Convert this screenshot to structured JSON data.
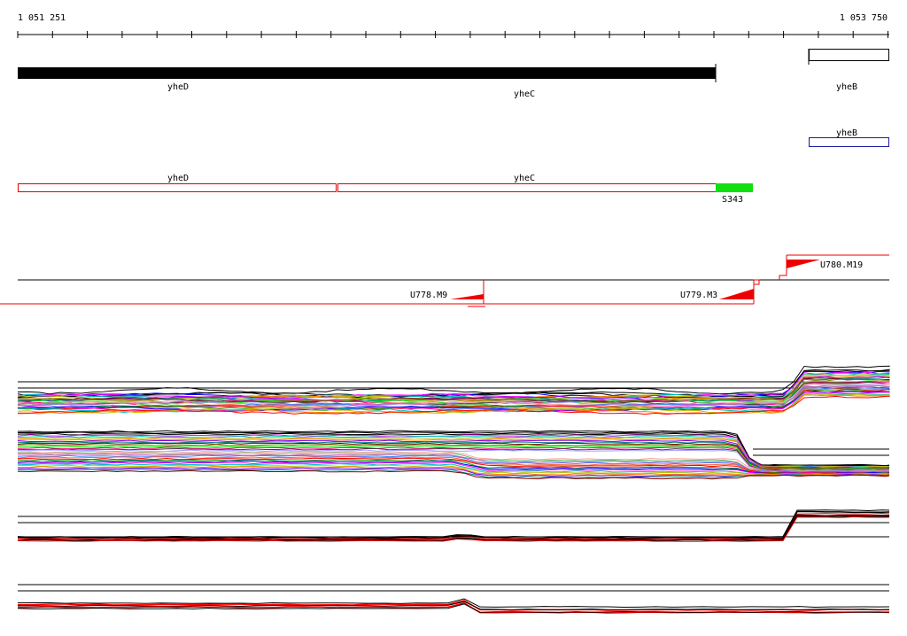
{
  "coordinates": {
    "start": "1 051 251",
    "end": "1 053 750"
  },
  "genes": [
    {
      "label": "yheD"
    },
    {
      "label": "yheC"
    },
    {
      "label": "yheB"
    }
  ],
  "annotation_second": {
    "label": "yheB"
  },
  "annotation_third": [
    {
      "label": "yheD"
    },
    {
      "label": "yheC"
    },
    {
      "label": "S343"
    }
  ],
  "features": [
    {
      "label": "U778.M9"
    },
    {
      "label": "U779.M3"
    },
    {
      "label": "U780.M19"
    }
  ],
  "colors": {
    "gene_fill": "#000000",
    "outline_red": "#e00000",
    "outline_blue": "#1a1aa0",
    "region_green": "#10e010",
    "feature_red": "#ee0000"
  }
}
